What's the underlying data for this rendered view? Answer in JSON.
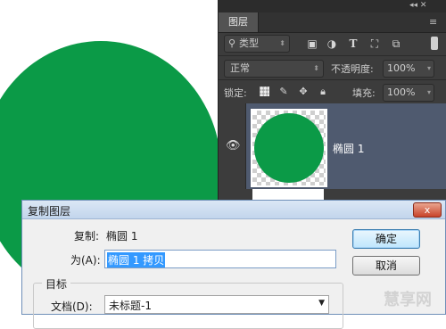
{
  "colors": {
    "shape_fill": "#0b9a47",
    "panel_bg": "#3c3c3c",
    "selected_layer": "#4f5a6f",
    "selection_highlight": "#3399ff"
  },
  "panel": {
    "top_glyphs": "◂◂  ✕",
    "tab_label": "图层",
    "menu_icon": "menu-lines-icon",
    "filter": {
      "label": "类型",
      "icons": [
        "image-filter-icon",
        "adjustment-filter-icon",
        "type-filter-icon",
        "shape-filter-icon",
        "smart-object-filter-icon"
      ]
    },
    "blend_mode": "正常",
    "opacity_label": "不透明度:",
    "opacity_value": "100%",
    "lock_label": "锁定:",
    "fill_label": "填充:",
    "fill_value": "100%",
    "layers": [
      {
        "name": "椭圆 1",
        "visible": true,
        "selected": true
      }
    ]
  },
  "dialog": {
    "title": "复制图层",
    "close_label": "x",
    "duplicate_label": "复制:",
    "duplicate_value": "椭圆 1",
    "as_label": "为(A):",
    "as_value": "椭圆 1 拷贝",
    "target_label": "目标",
    "document_label": "文档(D):",
    "document_value": "未标题-1",
    "ok_label": "确定",
    "cancel_label": "取消"
  },
  "watermark": "慧享网"
}
